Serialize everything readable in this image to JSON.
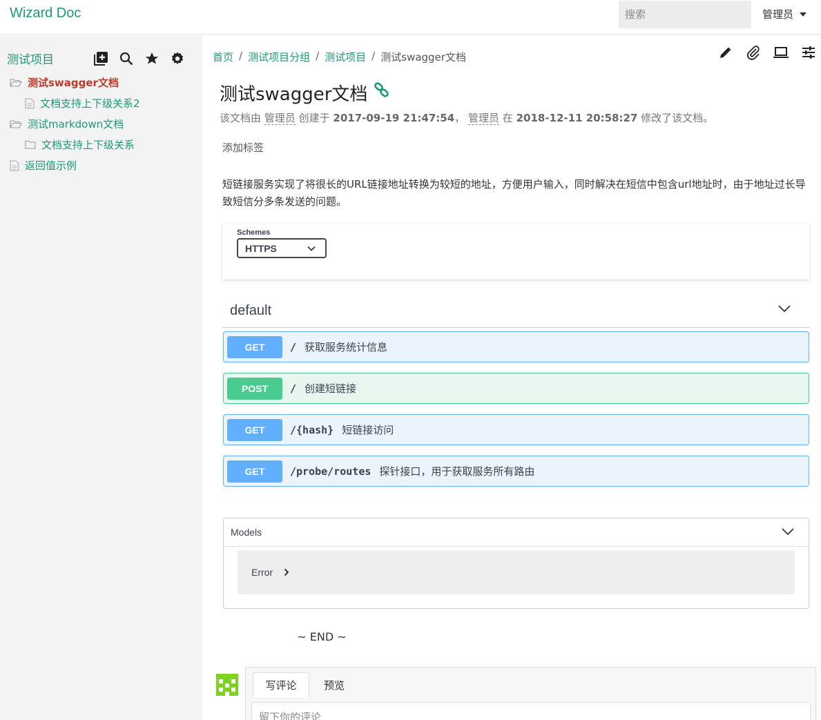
{
  "header": {
    "brand": "Wizard Doc",
    "search_placeholder": "搜索",
    "user_label": "管理员"
  },
  "sidebar": {
    "project_title": "测试项目",
    "tool_icons": [
      "add-doc-icon",
      "search-icon",
      "star-icon",
      "gear-icon"
    ],
    "items": [
      {
        "label": "测试swagger文档",
        "icon": "folder-open-icon",
        "active": true
      },
      {
        "label": "文档支持上下级关系2",
        "icon": "file-icon",
        "active": false
      },
      {
        "label": "测试markdown文档",
        "icon": "folder-open-icon",
        "active": false
      },
      {
        "label": "文档支持上下级关系",
        "icon": "folder-icon",
        "active": false
      },
      {
        "label": "返回值示例",
        "icon": "file-icon",
        "active": false
      }
    ]
  },
  "breadcrumb": [
    "首页",
    "测试项目分组",
    "测试项目",
    "测试swagger文档"
  ],
  "doc_tools": [
    "pencil-icon",
    "paperclip-icon",
    "laptop-icon",
    "sliders-icon"
  ],
  "doc": {
    "title": "测试swagger文档",
    "meta_prefix": "该文档由",
    "creator": "管理员",
    "created_text": "创建于",
    "created_at": "2017-09-19 21:47:54",
    "comma": "，",
    "modifier": "管理员",
    "modified_text": "在",
    "modified_at": "2018-12-11 20:58:27",
    "modified_suffix": "修改了该文档。",
    "add_tag": "添加标签",
    "description": "短链接服务实现了将很长的URL链接地址转换为较短的地址，方便用户输入，同时解决在短信中包含url地址时，由于地址过长导致短信分多条发送的问题。"
  },
  "swagger": {
    "schemes_label": "Schemes",
    "schemes_value": "HTTPS",
    "tag_name": "default",
    "operations": [
      {
        "method": "GET",
        "path": "/",
        "summary": "获取服务统计信息"
      },
      {
        "method": "POST",
        "path": "/",
        "summary": "创建短链接"
      },
      {
        "method": "GET",
        "path": "/{hash}",
        "summary": "短链接访问"
      },
      {
        "method": "GET",
        "path": "/probe/routes",
        "summary": "探针接口，用于获取服务所有路由"
      }
    ],
    "models_title": "Models",
    "model_items": [
      "Error"
    ]
  },
  "end_text": "~ END ~",
  "comments": {
    "tab_write": "写评论",
    "tab_preview": "预览",
    "placeholder": "留下你的评论"
  },
  "colors": {
    "brand": "#1a9977",
    "active_item": "#c0392b",
    "get": "#61affe",
    "post": "#49cc90"
  }
}
